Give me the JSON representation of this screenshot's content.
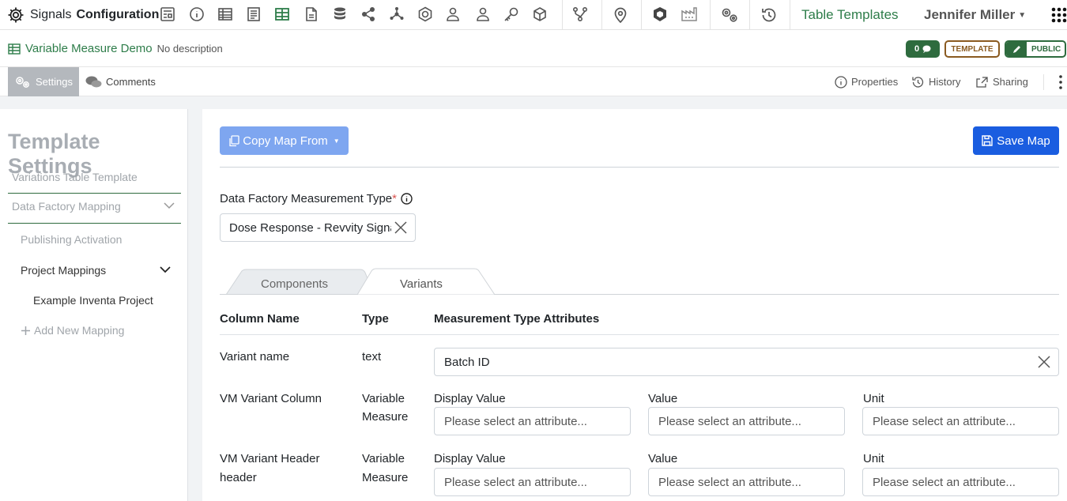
{
  "topbar": {
    "brand_prefix": "Signals",
    "brand_bold": "Configuration",
    "section_label": "Table Templates",
    "user_name": "Jennifer Miller",
    "icons": [
      "form-icon",
      "info-icon",
      "table-icon",
      "document-icon",
      "table-green-icon",
      "file-icon",
      "database-icon",
      "share-icon",
      "network-icon",
      "hexagon-icon",
      "user-gear-icon",
      "user-icon",
      "key-icon",
      "cube-icon",
      "branch-icon",
      "map-pin-icon",
      "shield-icon",
      "factory-icon",
      "gears-icon",
      "history-icon",
      "apps-grid-icon"
    ]
  },
  "entity": {
    "name": "Variable Measure Demo",
    "description": "No description",
    "comment_count": "0",
    "template_badge": "TEMPLATE",
    "public_badge": "PUBLIC"
  },
  "tabs": {
    "settings": "Settings",
    "comments": "Comments",
    "properties": "Properties",
    "history": "History",
    "sharing": "Sharing"
  },
  "sidebar": {
    "title": "Template Settings",
    "items": [
      {
        "label": "Variations Table Template"
      },
      {
        "label": "Data Factory Mapping"
      },
      {
        "label": "Publishing Activation"
      },
      {
        "label": "Project Mappings"
      },
      {
        "label": "Example Inventa Project"
      },
      {
        "label": "Add New Mapping"
      }
    ]
  },
  "main": {
    "copy_button": "Copy Map From",
    "save_button": "Save Map",
    "measurement_type_label": "Data Factory Measurement Type",
    "required_mark": "*",
    "measurement_type_value": "Dose Response - Revvity Signals",
    "subtabs": [
      "Components",
      "Variants"
    ],
    "active_subtab": "Variants",
    "headers": {
      "column_name": "Column Name",
      "type": "Type",
      "attributes": "Measurement Type Attributes"
    },
    "rows": [
      {
        "column_name": "Variant name",
        "type": "text",
        "value": "Batch ID"
      },
      {
        "column_name": "VM Variant Column",
        "type_line1": "Variable",
        "type_line2": "Measure",
        "sub_labels": [
          "Display Value",
          "Value",
          "Unit"
        ]
      },
      {
        "column_name_line1": "VM Variant Header",
        "column_name_line2": "header",
        "type_line1": "Variable",
        "type_line2": "Measure",
        "sub_labels": [
          "Display Value",
          "Value",
          "Unit"
        ]
      }
    ],
    "attribute_placeholder": "Please select an attribute..."
  },
  "colors": {
    "brand_green": "#2e7d4a",
    "primary_blue": "#1a5de0",
    "light_blue": "#7ea6f0",
    "template_brown": "#8a5a20"
  }
}
